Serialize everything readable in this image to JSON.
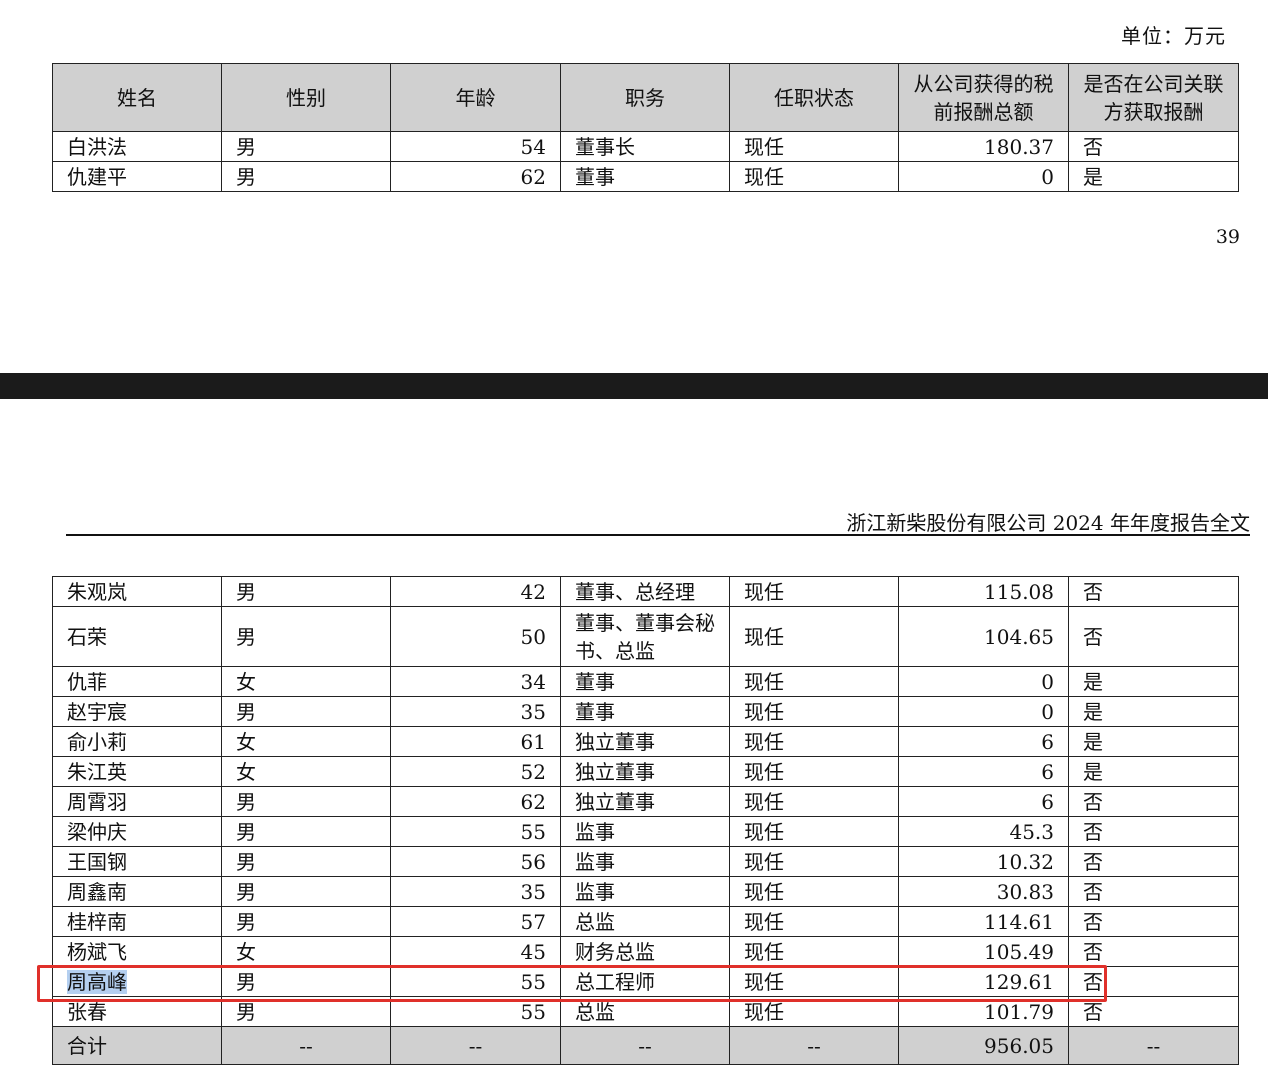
{
  "unit_label": "单位：万元",
  "page_number": "39",
  "doc_header": "浙江新柴股份有限公司 2024 年年度报告全文",
  "columns": [
    "姓名",
    "性别",
    "年龄",
    "职务",
    "任职状态",
    "从公司获得的税前报酬总额",
    "是否在公司关联方获取报酬"
  ],
  "rows_page1": [
    {
      "name": "白洪法",
      "gender": "男",
      "age": "54",
      "position": "董事长",
      "status": "现任",
      "pay": "180.37",
      "related": "否"
    },
    {
      "name": "仇建平",
      "gender": "男",
      "age": "62",
      "position": "董事",
      "status": "现任",
      "pay": "0",
      "related": "是"
    }
  ],
  "rows_page2": [
    {
      "name": "朱观岚",
      "gender": "男",
      "age": "42",
      "position": "董事、总经理",
      "status": "现任",
      "pay": "115.08",
      "related": "否"
    },
    {
      "name": "石荣",
      "gender": "男",
      "age": "50",
      "position": "董事、董事会秘书、总监",
      "status": "现任",
      "pay": "104.65",
      "related": "否"
    },
    {
      "name": "仇菲",
      "gender": "女",
      "age": "34",
      "position": "董事",
      "status": "现任",
      "pay": "0",
      "related": "是"
    },
    {
      "name": "赵宇宸",
      "gender": "男",
      "age": "35",
      "position": "董事",
      "status": "现任",
      "pay": "0",
      "related": "是"
    },
    {
      "name": "俞小莉",
      "gender": "女",
      "age": "61",
      "position": "独立董事",
      "status": "现任",
      "pay": "6",
      "related": "是"
    },
    {
      "name": "朱江英",
      "gender": "女",
      "age": "52",
      "position": "独立董事",
      "status": "现任",
      "pay": "6",
      "related": "是"
    },
    {
      "name": "周霄羽",
      "gender": "男",
      "age": "62",
      "position": "独立董事",
      "status": "现任",
      "pay": "6",
      "related": "否"
    },
    {
      "name": "梁仲庆",
      "gender": "男",
      "age": "55",
      "position": "监事",
      "status": "现任",
      "pay": "45.3",
      "related": "否"
    },
    {
      "name": "王国钢",
      "gender": "男",
      "age": "56",
      "position": "监事",
      "status": "现任",
      "pay": "10.32",
      "related": "否"
    },
    {
      "name": "周鑫南",
      "gender": "男",
      "age": "35",
      "position": "监事",
      "status": "现任",
      "pay": "30.83",
      "related": "否"
    },
    {
      "name": "桂梓南",
      "gender": "男",
      "age": "57",
      "position": "总监",
      "status": "现任",
      "pay": "114.61",
      "related": "否"
    },
    {
      "name": "杨斌飞",
      "gender": "女",
      "age": "45",
      "position": "财务总监",
      "status": "现任",
      "pay": "105.49",
      "related": "否"
    },
    {
      "name": "周高峰",
      "gender": "男",
      "age": "55",
      "position": "总工程师",
      "status": "现任",
      "pay": "129.61",
      "related": "否"
    },
    {
      "name": "张春",
      "gender": "男",
      "age": "55",
      "position": "总监",
      "status": "现任",
      "pay": "101.79",
      "related": "否"
    }
  ],
  "total_row": {
    "label": "合计",
    "placeholder": "--",
    "pay": "956.05"
  }
}
